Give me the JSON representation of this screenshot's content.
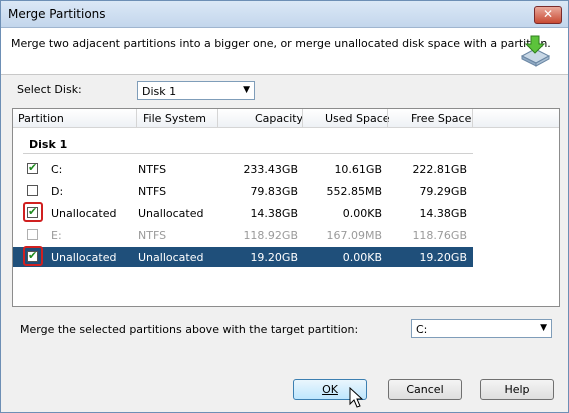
{
  "window": {
    "title": "Merge Partitions",
    "close_glyph": "✕"
  },
  "header": {
    "description": "Merge two adjacent partitions into a bigger one, or merge unallocated disk space with a partition."
  },
  "select_disk": {
    "label": "Select Disk:",
    "value": "Disk 1"
  },
  "table": {
    "columns": [
      "Partition",
      "File System",
      "Capacity",
      "Used Space",
      "Free Space"
    ],
    "group": "Disk 1",
    "rows": [
      {
        "partition": "C:",
        "fs": "NTFS",
        "capacity": "233.43GB",
        "used": "10.61GB",
        "free": "222.81GB",
        "checked": true,
        "selected": false,
        "disabled": false,
        "highlight": false
      },
      {
        "partition": "D:",
        "fs": "NTFS",
        "capacity": "79.83GB",
        "used": "552.85MB",
        "free": "79.29GB",
        "checked": false,
        "selected": false,
        "disabled": false,
        "highlight": false
      },
      {
        "partition": "Unallocated",
        "fs": "Unallocated",
        "capacity": "14.38GB",
        "used": "0.00KB",
        "free": "14.38GB",
        "checked": true,
        "selected": false,
        "disabled": false,
        "highlight": true
      },
      {
        "partition": "E:",
        "fs": "NTFS",
        "capacity": "118.92GB",
        "used": "167.09MB",
        "free": "118.76GB",
        "checked": false,
        "selected": false,
        "disabled": true,
        "highlight": false
      },
      {
        "partition": "Unallocated",
        "fs": "Unallocated",
        "capacity": "19.20GB",
        "used": "0.00KB",
        "free": "19.20GB",
        "checked": true,
        "selected": true,
        "disabled": false,
        "highlight": true
      }
    ]
  },
  "target": {
    "label": "Merge the selected partitions above with the target partition:",
    "value": "C:"
  },
  "buttons": {
    "ok": "OK",
    "cancel": "Cancel",
    "help": "Help"
  },
  "icons": {
    "dropdown": "▼",
    "check": "✔"
  },
  "colors": {
    "selection": "#1f4f7a",
    "highlight_border": "#d02020",
    "check": "#1f8b1f"
  }
}
